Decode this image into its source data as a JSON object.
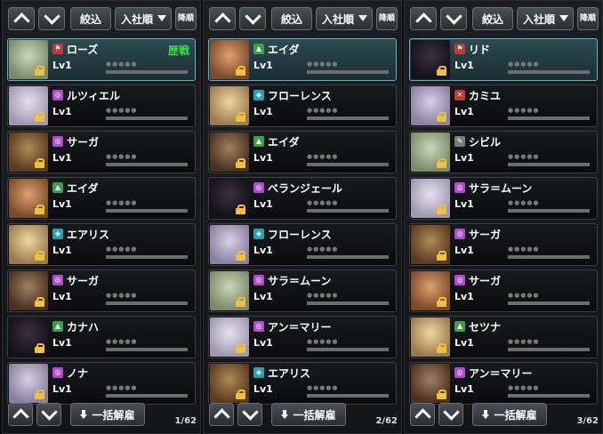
{
  "toolbar": {
    "filter_label": "絞込",
    "sort_label": "入社順",
    "order_label": "降順"
  },
  "footer": {
    "release_label": "一括解雇"
  },
  "colors": {
    "type_pink": "#b04ad0",
    "type_green": "#3aa04a",
    "type_teal": "#2aa0b0",
    "type_red": "#c03a3a",
    "type_white": "#7a7a7a"
  },
  "panels": [
    {
      "page": "1/62",
      "cards": [
        {
          "name": "ローズ",
          "level": "Lv1",
          "badge": "歴戦",
          "type": "red",
          "type_icon": "flag-icon",
          "selected": true
        },
        {
          "name": "ルツィエル",
          "level": "Lv1",
          "type": "pink",
          "type_icon": "swirl-icon"
        },
        {
          "name": "サーガ",
          "level": "Lv1",
          "type": "pink",
          "type_icon": "swirl-icon"
        },
        {
          "name": "エイダ",
          "level": "Lv1",
          "type": "green",
          "type_icon": "leaf-icon"
        },
        {
          "name": "エアリス",
          "level": "Lv1",
          "type": "teal",
          "type_icon": "shield-icon"
        },
        {
          "name": "サーガ",
          "level": "Lv1",
          "type": "pink",
          "type_icon": "swirl-icon"
        },
        {
          "name": "カナハ",
          "level": "Lv1",
          "type": "green",
          "type_icon": "leaf-icon"
        },
        {
          "name": "ノナ",
          "level": "Lv1",
          "type": "pink",
          "type_icon": "swirl-icon"
        }
      ]
    },
    {
      "page": "2/62",
      "cards": [
        {
          "name": "エイダ",
          "level": "Lv1",
          "type": "green",
          "type_icon": "leaf-icon",
          "selected": true
        },
        {
          "name": "フローレンス",
          "level": "Lv1",
          "type": "teal",
          "type_icon": "shield-icon"
        },
        {
          "name": "エイダ",
          "level": "Lv1",
          "type": "green",
          "type_icon": "leaf-icon"
        },
        {
          "name": "ベランジェール",
          "level": "Lv1",
          "type": "pink",
          "type_icon": "swirl-icon"
        },
        {
          "name": "フローレンス",
          "level": "Lv1",
          "type": "teal",
          "type_icon": "shield-icon"
        },
        {
          "name": "サラ＝ムーン",
          "level": "Lv1",
          "type": "pink",
          "type_icon": "swirl-icon"
        },
        {
          "name": "アン＝マリー",
          "level": "Lv1",
          "type": "pink",
          "type_icon": "swirl-icon"
        },
        {
          "name": "エアリス",
          "level": "Lv1",
          "type": "teal",
          "type_icon": "shield-icon"
        }
      ]
    },
    {
      "page": "3/62",
      "cards": [
        {
          "name": "リド",
          "level": "Lv1",
          "type": "red",
          "type_icon": "flag-icon",
          "selected": true
        },
        {
          "name": "カミユ",
          "level": "Lv1",
          "type": "red",
          "type_icon": "cross-swords-icon"
        },
        {
          "name": "シビル",
          "level": "Lv1",
          "type": "white",
          "type_icon": "feather-icon"
        },
        {
          "name": "サラ＝ムーン",
          "level": "Lv1",
          "type": "pink",
          "type_icon": "swirl-icon"
        },
        {
          "name": "サーガ",
          "level": "Lv1",
          "type": "pink",
          "type_icon": "swirl-icon"
        },
        {
          "name": "サーガ",
          "level": "Lv1",
          "type": "pink",
          "type_icon": "swirl-icon"
        },
        {
          "name": "セツナ",
          "level": "Lv1",
          "type": "green",
          "type_icon": "leaf-icon"
        },
        {
          "name": "アン＝マリー",
          "level": "Lv1",
          "type": "pink",
          "type_icon": "swirl-icon"
        }
      ]
    }
  ]
}
